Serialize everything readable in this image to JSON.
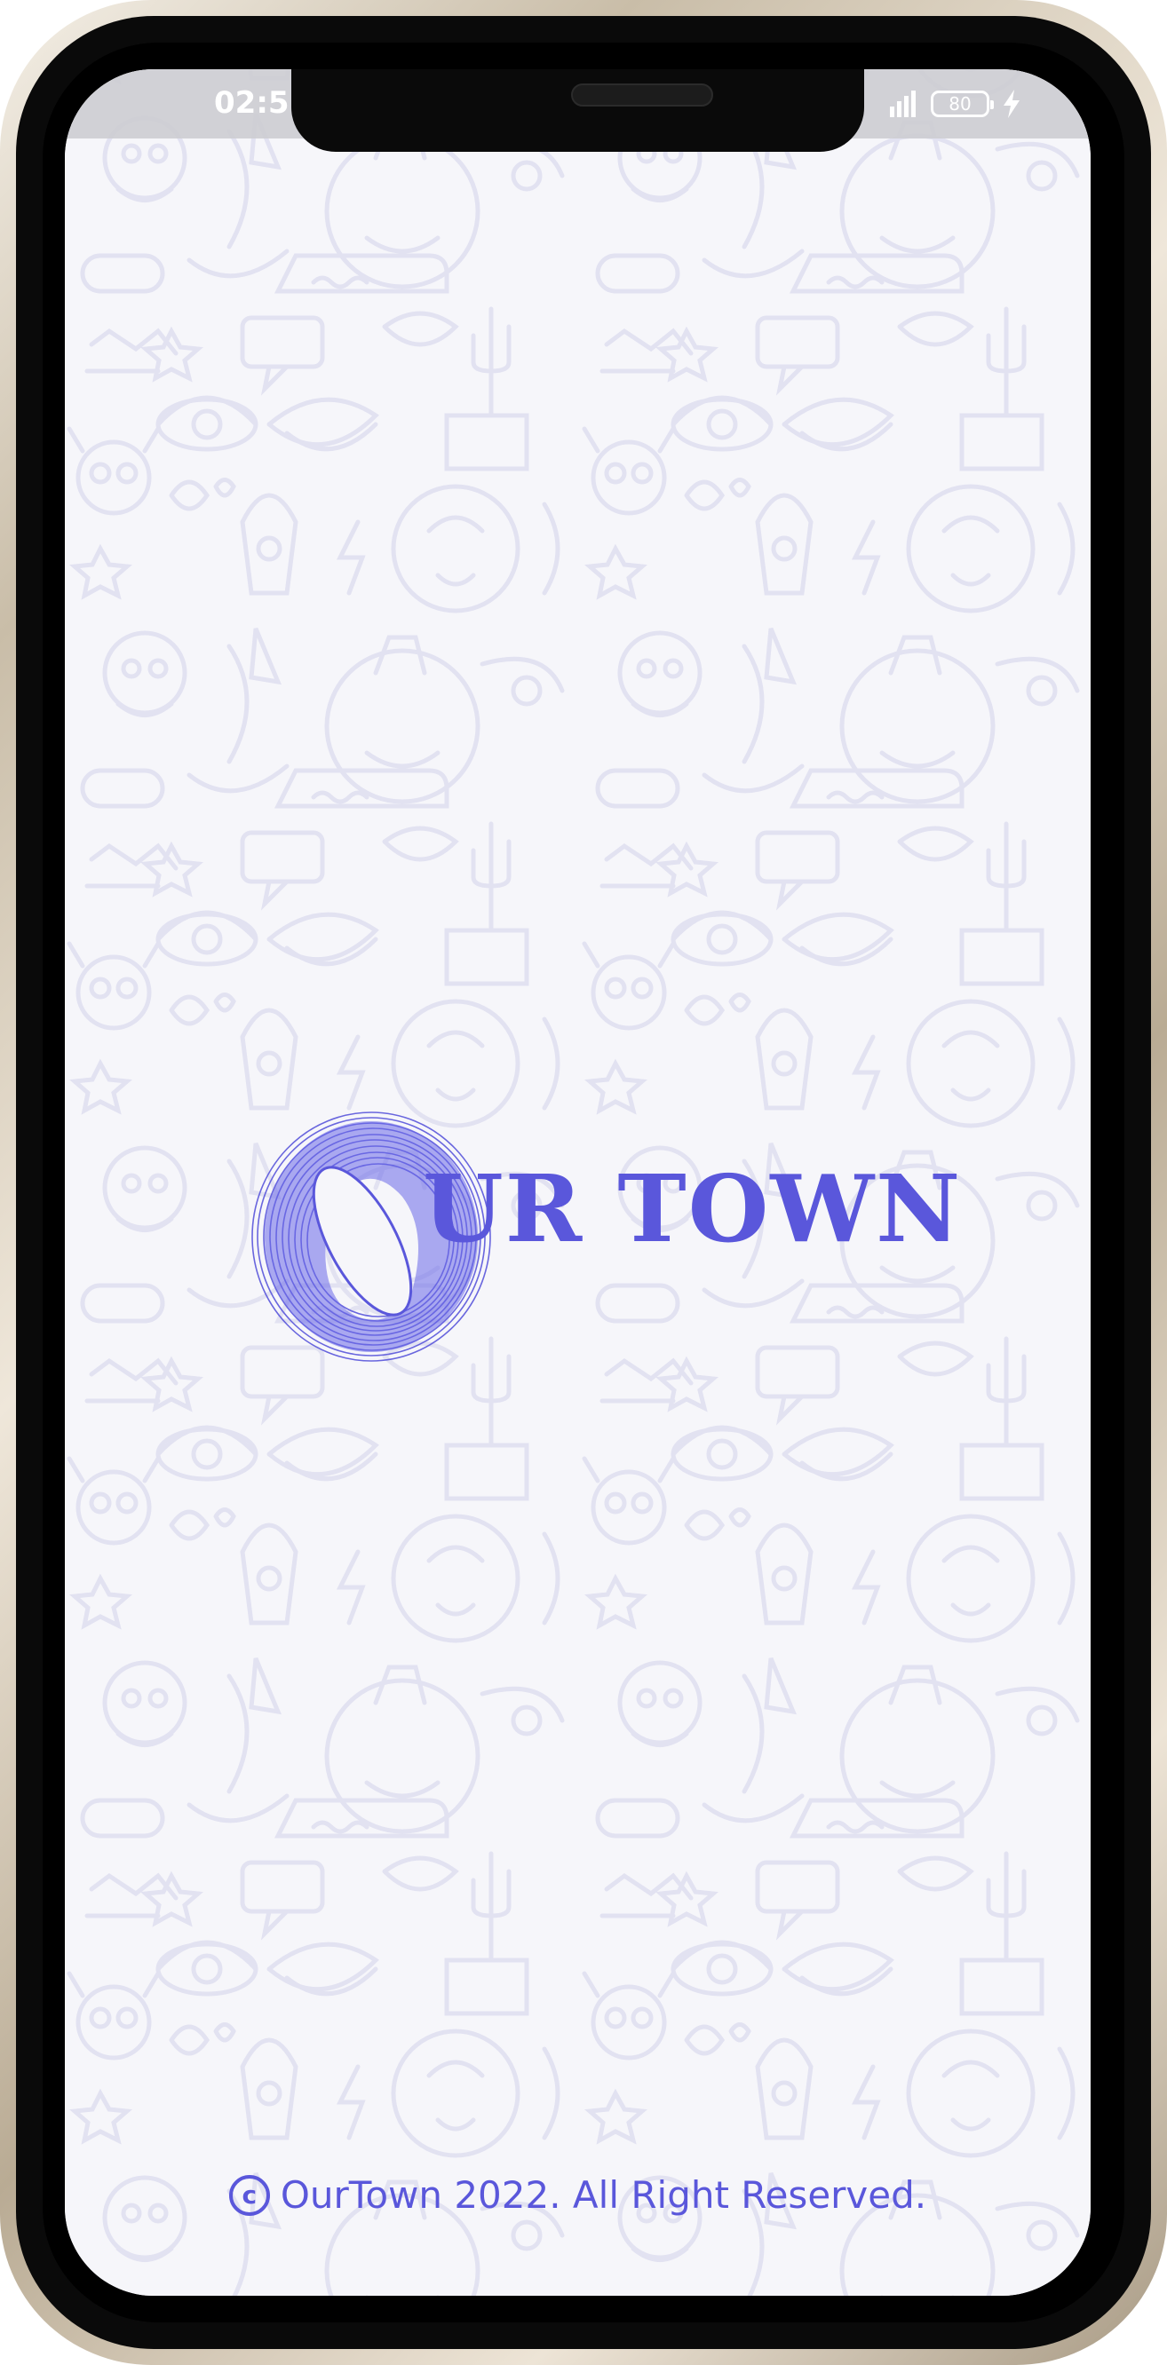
{
  "status_bar": {
    "time": "02:5",
    "battery_level": "80",
    "signal_icon": "signal-bars-icon",
    "charge_icon": "charging-bolt-icon"
  },
  "logo": {
    "text": "UR TOWN",
    "ring_icon": "swirl-ring-o-icon"
  },
  "footer": {
    "copyright_symbol": "c",
    "text": "OurTown 2022. All Right Reserved."
  },
  "colors": {
    "brand": "#5a57db",
    "screen_background": "#f6f6fa",
    "doodle": "#e6e6f3"
  }
}
